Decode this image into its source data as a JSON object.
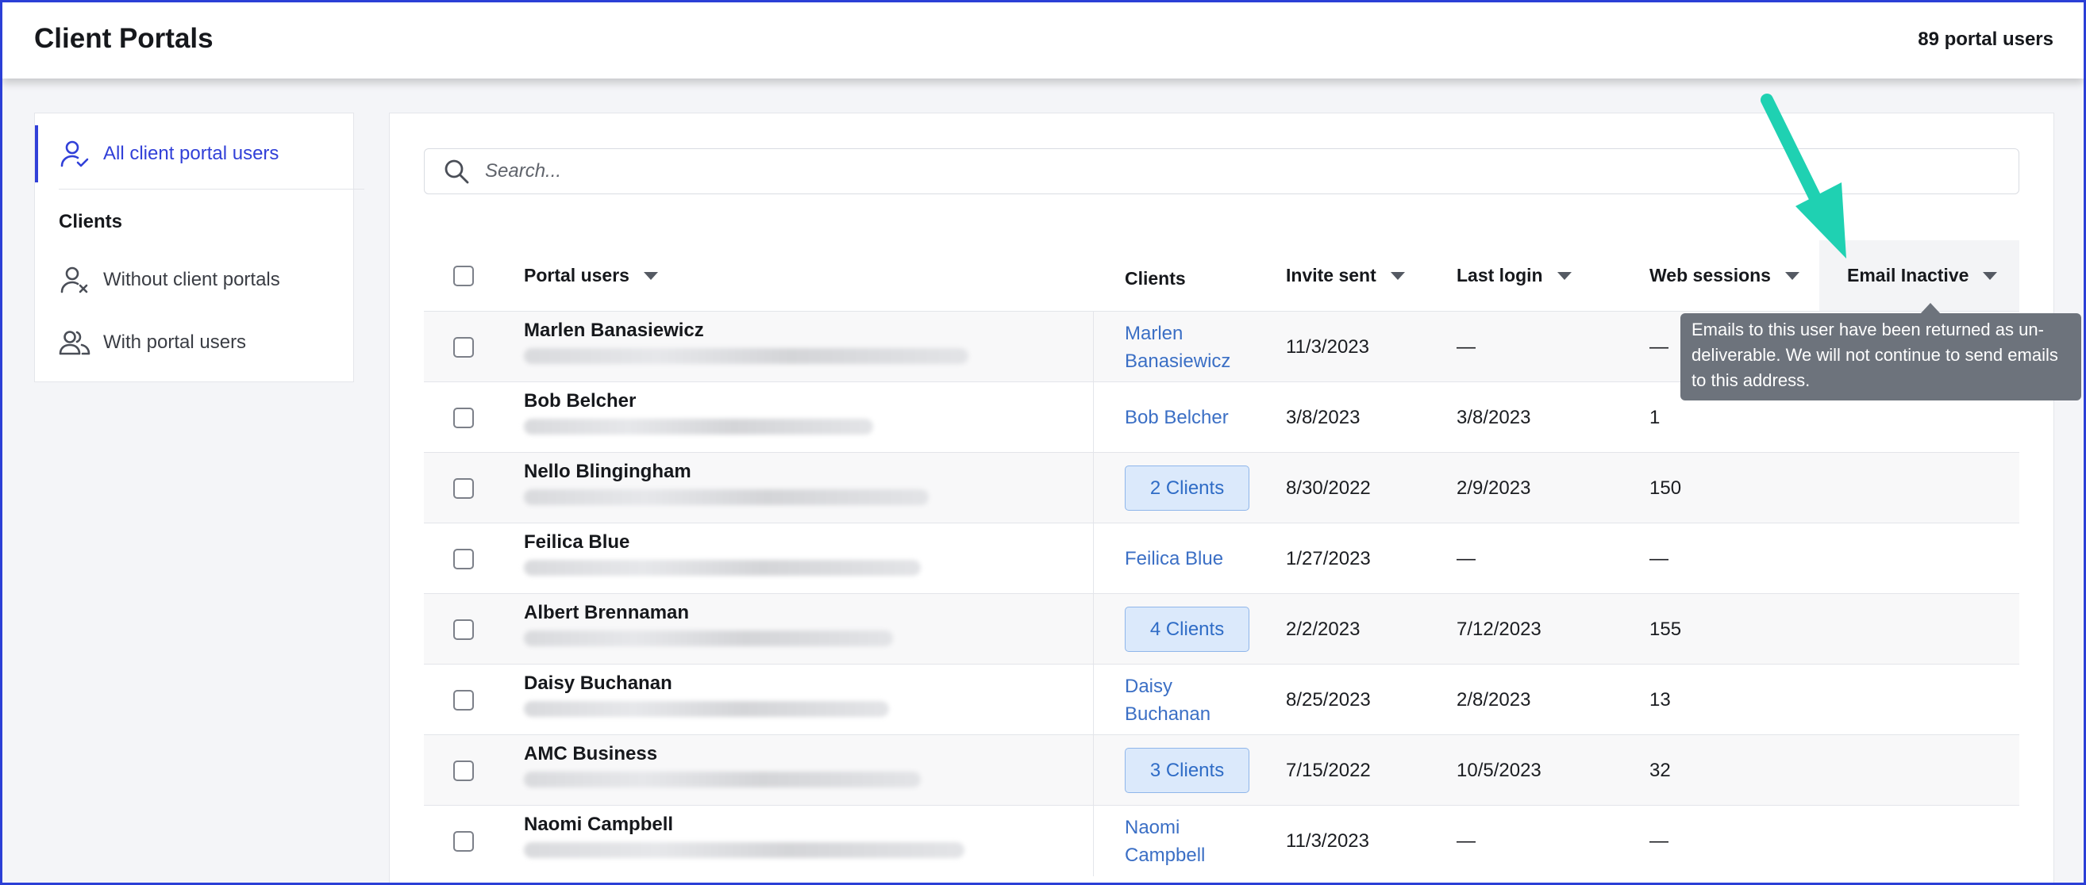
{
  "header": {
    "title": "Client Portals",
    "count_label": "89 portal users"
  },
  "sidebar": {
    "items": [
      {
        "label": "All client portal users",
        "icon": "user-check-icon",
        "active": true
      }
    ],
    "heading": "Clients",
    "client_items": [
      {
        "label": "Without client portals",
        "icon": "user-x-icon"
      },
      {
        "label": "With portal users",
        "icon": "users-icon"
      }
    ]
  },
  "search": {
    "placeholder": "Search...",
    "icon": "search-icon"
  },
  "table": {
    "columns": [
      {
        "label": "Portal users",
        "sortable": true
      },
      {
        "label": "Clients",
        "sortable": false
      },
      {
        "label": "Invite sent",
        "sortable": true
      },
      {
        "label": "Last login",
        "sortable": true
      },
      {
        "label": "Web sessions",
        "sortable": true
      },
      {
        "label": "Email Inactive",
        "sortable": true
      }
    ],
    "rows": [
      {
        "name": "Marlen Banasiewicz",
        "clients": "Marlen\nBanasiewicz",
        "clients_type": "link",
        "invite_sent": "11/3/2023",
        "last_login": "—",
        "web_sessions": "—"
      },
      {
        "name": "Bob Belcher",
        "clients": "Bob Belcher",
        "clients_type": "link",
        "invite_sent": "3/8/2023",
        "last_login": "3/8/2023",
        "web_sessions": "1"
      },
      {
        "name": "Nello Blingingham",
        "clients": "2 Clients",
        "clients_type": "badge",
        "invite_sent": "8/30/2022",
        "last_login": "2/9/2023",
        "web_sessions": "150"
      },
      {
        "name": "Feilica Blue",
        "clients": "Feilica Blue",
        "clients_type": "link",
        "invite_sent": "1/27/2023",
        "last_login": "—",
        "web_sessions": "—"
      },
      {
        "name": "Albert Brennaman",
        "clients": "4 Clients",
        "clients_type": "badge",
        "invite_sent": "2/2/2023",
        "last_login": "7/12/2023",
        "web_sessions": "155"
      },
      {
        "name": "Daisy Buchanan",
        "clients": "Daisy\nBuchanan",
        "clients_type": "link",
        "invite_sent": "8/25/2023",
        "last_login": "2/8/2023",
        "web_sessions": "13"
      },
      {
        "name": "AMC Business",
        "clients": "3 Clients",
        "clients_type": "badge",
        "invite_sent": "7/15/2022",
        "last_login": "10/5/2023",
        "web_sessions": "32"
      },
      {
        "name": "Naomi Campbell",
        "clients": "Naomi\nCampbell",
        "clients_type": "link",
        "invite_sent": "11/3/2023",
        "last_login": "—",
        "web_sessions": "—"
      }
    ]
  },
  "tooltip": {
    "text": "Emails to this user have been returned as un-deliverable. We will not continue to send emails to this address."
  },
  "colors": {
    "accent": "#3140d8",
    "link": "#3b6fc5",
    "annotation_arrow": "#1fd1b2",
    "tooltip_bg": "#6d737c"
  }
}
